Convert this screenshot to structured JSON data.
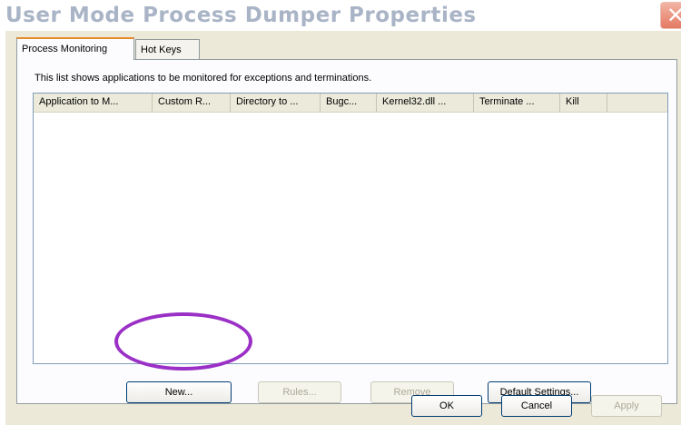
{
  "window": {
    "title": "User Mode Process Dumper Properties",
    "close_glyph": "✕"
  },
  "tabs": [
    {
      "label": "Process Monitoring",
      "active": true
    },
    {
      "label": "Hot Keys",
      "active": false
    }
  ],
  "panel": {
    "description": "This list shows applications to be monitored for exceptions and terminations."
  },
  "list": {
    "columns": [
      "Application to M...",
      "Custom R...",
      "Directory to ...",
      "Bugc...",
      "Kernel32.dll ...",
      "Terminate ...",
      "Kill"
    ],
    "rows": []
  },
  "panel_buttons": {
    "new": "New...",
    "rules": "Rules...",
    "remove": "Remove",
    "default_settings": "Default Settings..."
  },
  "dialog_buttons": {
    "ok": "OK",
    "cancel": "Cancel",
    "apply": "Apply"
  },
  "annotation": {
    "color": "#9b30c6",
    "target": "New..."
  }
}
